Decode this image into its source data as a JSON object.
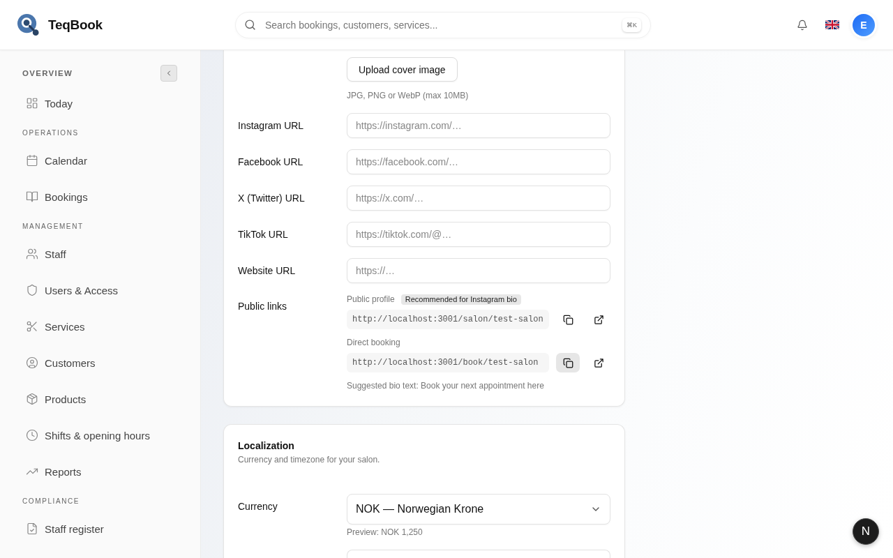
{
  "header": {
    "brand": "TeqBook",
    "search": {
      "placeholder": "Search bookings, customers, services...",
      "shortcut": "⌘K"
    },
    "avatar": "E"
  },
  "sidebar": {
    "sections": [
      {
        "title": "OVERVIEW",
        "items": [
          {
            "label": "Today",
            "selected": false
          }
        ]
      },
      {
        "title": "OPERATIONS",
        "items": [
          {
            "label": "Calendar",
            "selected": false
          },
          {
            "label": "Bookings",
            "selected": false
          }
        ]
      },
      {
        "title": "MANAGEMENT",
        "items": [
          {
            "label": "Staff",
            "selected": false
          },
          {
            "label": "Users & Access",
            "selected": false
          },
          {
            "label": "Services",
            "selected": false
          },
          {
            "label": "Customers",
            "selected": false
          },
          {
            "label": "Products",
            "selected": false
          },
          {
            "label": "Shifts & opening hours",
            "selected": false
          },
          {
            "label": "Reports",
            "selected": false
          }
        ]
      },
      {
        "title": "COMPLIANCE",
        "items": [
          {
            "label": "Staff register",
            "selected": false
          }
        ]
      }
    ]
  },
  "profile_card": {
    "upload_button": "Upload cover image",
    "upload_hint": "JPG, PNG or WebP (max 10MB)",
    "social_fields": [
      {
        "label": "Instagram URL",
        "placeholder": "https://instagram.com/…"
      },
      {
        "label": "Facebook URL",
        "placeholder": "https://facebook.com/…"
      },
      {
        "label": "X (Twitter) URL",
        "placeholder": "https://x.com/…"
      },
      {
        "label": "TikTok URL",
        "placeholder": "https://tiktok.com/@…"
      },
      {
        "label": "Website URL",
        "placeholder": "https://…"
      }
    ],
    "public_links": {
      "label": "Public links",
      "links": [
        {
          "label": "Public profile",
          "badge": "Recommended for Instagram bio",
          "url": "http://localhost:3001/salon/test-salon",
          "copy_hovered": false
        },
        {
          "label": "Direct booking",
          "url": "http://localhost:3001/book/test-salon",
          "copy_hovered": true
        }
      ],
      "suggested_bio": "Suggested bio text: Book your next appointment here"
    }
  },
  "localization_card": {
    "title": "Localization",
    "subtitle": "Currency and timezone for your salon.",
    "fields": [
      {
        "kind": "select",
        "label": "Currency",
        "value": "NOK — Norwegian Krone",
        "hint": "Preview: NOK 1,250"
      },
      {
        "kind": "select"
      }
    ]
  },
  "dev_indicator": {
    "label": "N"
  }
}
